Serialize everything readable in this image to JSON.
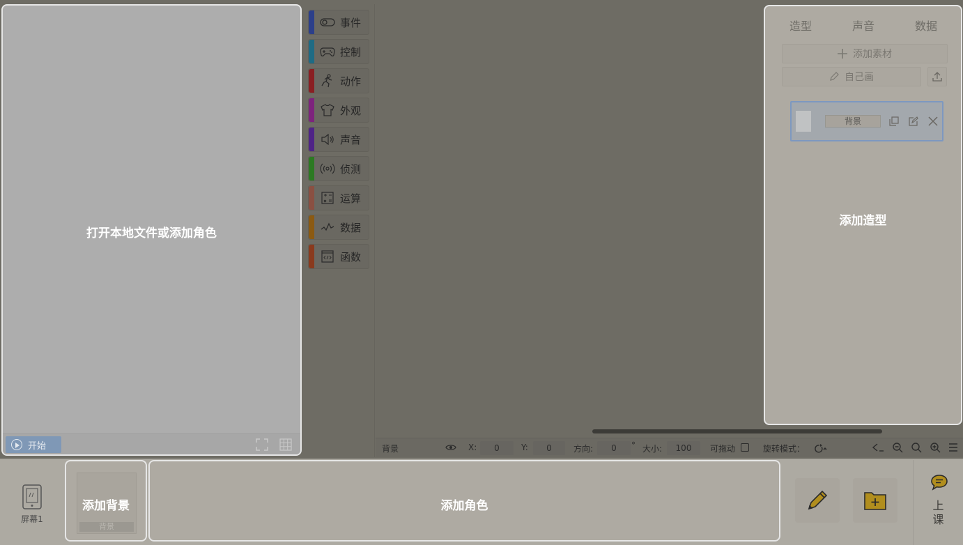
{
  "stage": {
    "hint": "打开本地文件或添加角色",
    "start_label": "开始",
    "fullscreen_icon": "fullscreen-icon",
    "grid_icon": "grid-icon"
  },
  "categories": [
    {
      "label": "事件",
      "color": "#2c3f8a",
      "icon": "toggle-icon"
    },
    {
      "label": "控制",
      "color": "#1f6b84",
      "icon": "gamepad-icon"
    },
    {
      "label": "动作",
      "color": "#8a1f22",
      "icon": "running-icon"
    },
    {
      "label": "外观",
      "color": "#7d237d",
      "icon": "shirt-icon"
    },
    {
      "label": "声音",
      "color": "#4f2386",
      "icon": "speaker-icon"
    },
    {
      "label": "侦测",
      "color": "#2c7a22",
      "icon": "signal-icon"
    },
    {
      "label": "运算",
      "color": "#8a5042",
      "icon": "calculator-icon"
    },
    {
      "label": "数据",
      "color": "#8b5a12",
      "icon": "chart-icon"
    },
    {
      "label": "函数",
      "color": "#8a3a1d",
      "icon": "code-icon"
    }
  ],
  "props": {
    "name": "背景",
    "x_label": "X:",
    "x_value": "0",
    "y_label": "Y:",
    "y_value": "0",
    "dir_label": "方向:",
    "dir_value": "0",
    "degree": "°",
    "size_label": "大小:",
    "size_value": "100",
    "draggable_label": "可拖动",
    "rotation_label": "旋转模式："
  },
  "right": {
    "tabs": [
      "造型",
      "声音",
      "数据"
    ],
    "add_material": "添加素材",
    "draw_self": "自己画",
    "costume_name": "背景",
    "hint": "添加造型"
  },
  "bottom": {
    "screen_label": "屏幕1",
    "bg_hint": "添加背景",
    "bg_label": "背景",
    "sprite_hint": "添加角色",
    "class_label": "上课"
  }
}
